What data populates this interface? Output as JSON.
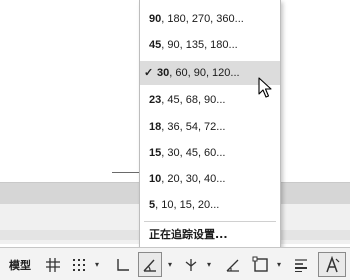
{
  "menu": {
    "items": [
      {
        "lead": "90",
        "rest": ", 180, 270, 360...",
        "selected": false
      },
      {
        "lead": "45",
        "rest": ", 90, 135, 180...",
        "selected": false
      },
      {
        "lead": "30",
        "rest": ", 60, 90, 120...",
        "selected": true
      },
      {
        "lead": "23",
        "rest": ", 45, 68, 90...",
        "selected": false
      },
      {
        "lead": "18",
        "rest": ", 36, 54, 72...",
        "selected": false
      },
      {
        "lead": "15",
        "rest": ", 30, 45, 60...",
        "selected": false
      },
      {
        "lead": "10",
        "rest": ", 20, 30, 40...",
        "selected": false
      },
      {
        "lead": "5",
        "rest": ", 10, 15, 20...",
        "selected": false
      }
    ],
    "check_mark": "✓",
    "tracking_settings": "正在追踪设置..."
  },
  "statusbar": {
    "model_tab": "模型",
    "caret": "▾",
    "icons": [
      "grid-icon",
      "snap-dots-icon",
      "ortho-icon",
      "polar-tracking-icon",
      "isodraft-icon",
      "object-snap-tracking-icon",
      "object-snap-icon",
      "lineweight-icon",
      "annotation-scale-icon"
    ]
  },
  "colors": {
    "menu_selected_bg": "#dcdcdc",
    "canvas_bg": "#ffffff",
    "gray_band": "#d6d6d6",
    "statusbar_bg": "#f3f3f3"
  }
}
